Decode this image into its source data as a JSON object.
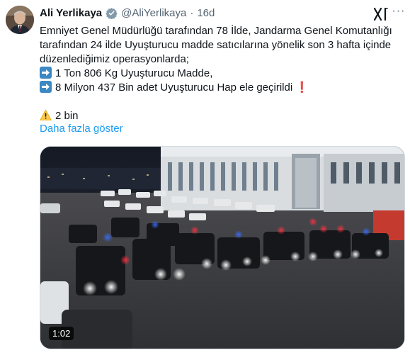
{
  "tweet": {
    "author_name": "Ali Yerlikaya",
    "handle": "@AliYerlikaya",
    "separator": "·",
    "time": "16d",
    "body_lines": [
      "Emniyet Genel Müdürlüğü tarafından 78 İlde, Jandarma Genel Komutanlığı",
      "tarafından 24 ilde Uyuşturucu madde satıcılarına yönelik son 3 hafta içinde",
      "düzenlediğimiz operasyonlarda;"
    ],
    "bullet_1": "1 Ton 806 Kg Uyuşturucu Madde,",
    "bullet_2": "8 Milyon 437 Bin adet Uyuşturucu Hap ele geçirildi",
    "bullet_2_suffix": "❗",
    "views": "2 bin",
    "show_more": "Daha fazla göster",
    "more_icon": "···",
    "video_duration": "1:02",
    "verified_color": "#829aab",
    "link_color": "#1d9bf0",
    "bullet_icon": "right-arrow-icon",
    "views_icon": "warning-icon"
  }
}
